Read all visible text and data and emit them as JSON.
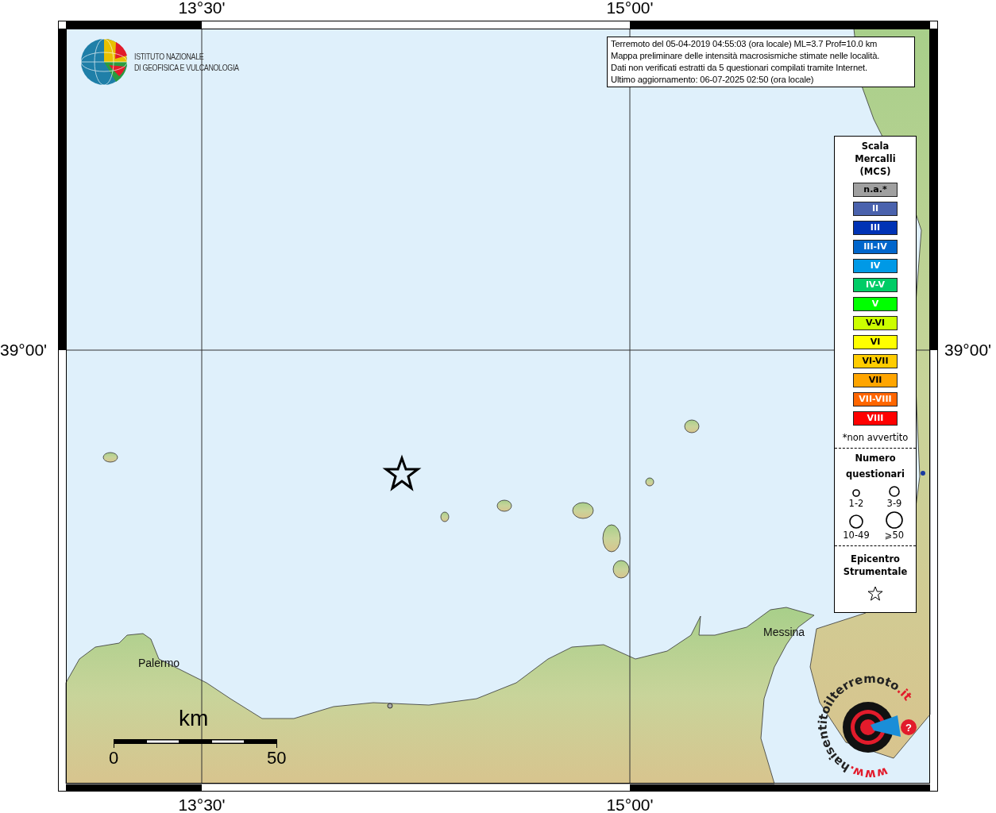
{
  "map": {
    "grid_labels": {
      "top": [
        "13°30'",
        "15°00'"
      ],
      "bottom": [
        "13°30'",
        "15°00'"
      ],
      "left": [
        "39°00'"
      ],
      "right": [
        "39°00'"
      ]
    },
    "institute_logo": [
      "ISTITUTO NAZIONALE",
      "DI GEOFISICA E VULCANOLOGIA"
    ],
    "info_box": [
      "Terremoto del 05-04-2019 04:55:03 (ora locale) ML=3.7 Prof=10.0 km",
      "Mappa preliminare delle intensità macrosismiche stimate nelle località.",
      "Dati non verificati estratti da 5 questionari compilati tramite Internet.",
      "Ultimo aggiornamento: 06-07-2025 02:50 (ora locale)"
    ],
    "places": [
      {
        "name": "Palermo"
      },
      {
        "name": "Messina"
      }
    ],
    "scale_bar": {
      "unit": "km",
      "start": "0",
      "end": "50"
    },
    "site_logo": {
      "prefix": "www.",
      "name": "haisentitoilterremoto",
      "suffix": ".it",
      "badge": "?"
    }
  },
  "legend": {
    "title": "Scala Mercalli (MCS)",
    "levels": [
      {
        "label": "n.a.*",
        "color": "#a0a0a0"
      },
      {
        "label": "II",
        "color": "#4a62ad"
      },
      {
        "label": "III",
        "color": "#0033b5"
      },
      {
        "label": "III-IV",
        "color": "#0066cc"
      },
      {
        "label": "IV",
        "color": "#0099e6"
      },
      {
        "label": "IV-V",
        "color": "#00cc66"
      },
      {
        "label": "V",
        "color": "#00ff00"
      },
      {
        "label": "V-VI",
        "color": "#ccff00"
      },
      {
        "label": "VI",
        "color": "#ffff00"
      },
      {
        "label": "VI-VII",
        "color": "#ffcc00"
      },
      {
        "label": "VII",
        "color": "#ffa500"
      },
      {
        "label": "VII-VIII",
        "color": "#ff6600"
      },
      {
        "label": "VIII",
        "color": "#ff0000"
      }
    ],
    "footnote": "*non avvertito",
    "responses_title": "Numero questionari",
    "responses": [
      "1-2",
      "3-9",
      "10-49",
      "⩾50"
    ],
    "epicenter_title": "Epicentro Strumentale"
  }
}
